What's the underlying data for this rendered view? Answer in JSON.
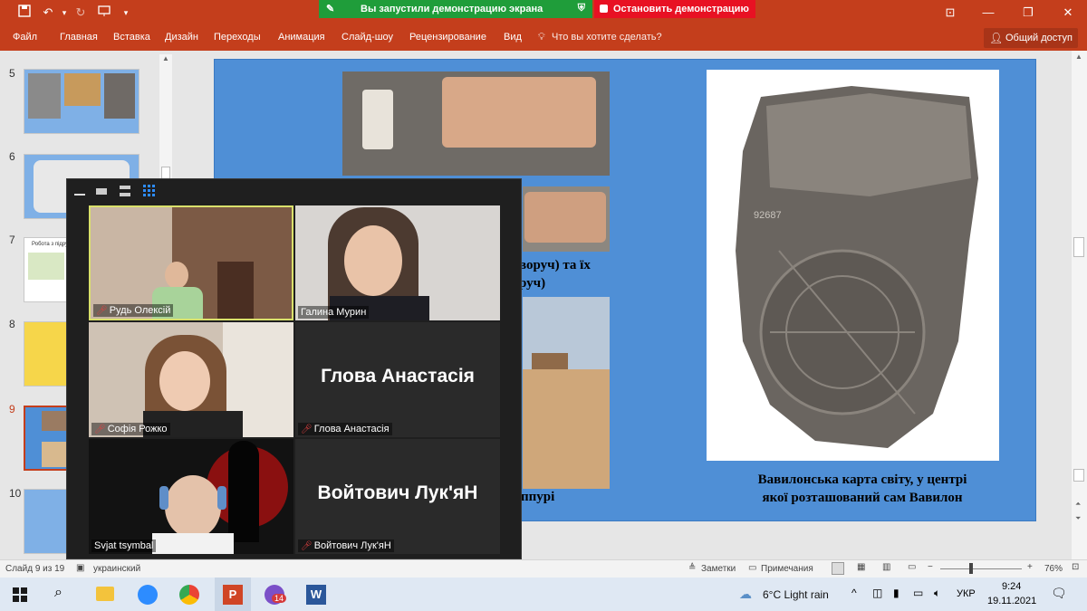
{
  "quick_access": {
    "save_icon": "save-icon",
    "undo_icon": "undo-icon",
    "redo_icon": "redo-icon",
    "present_icon": "present-icon"
  },
  "screen_share": {
    "message": "Вы запустили демонстрацию экрана",
    "stop_label": "Остановить демонстрацию"
  },
  "ribbon": {
    "tabs": [
      "Файл",
      "Главная",
      "Вставка",
      "Дизайн",
      "Переходы",
      "Анимация",
      "Слайд-шоу",
      "Рецензирование",
      "Вид"
    ],
    "tell_me": "Что вы хотите сделать?",
    "share_label": "Общий доступ"
  },
  "thumbnails": [
    {
      "num": "5"
    },
    {
      "num": "6"
    },
    {
      "num": "7",
      "text": "Робота з підру"
    },
    {
      "num": "8"
    },
    {
      "num": "9"
    },
    {
      "num": "10"
    }
  ],
  "slide": {
    "caption_left_1": "воруч) та їх",
    "caption_left_2": "руч)",
    "caption_bottom_left": "ппурі",
    "map_number": "92687",
    "caption_right_1": "Вавилонська карта світу,  у центрі",
    "caption_right_2": "якої розташований сам Вавилон"
  },
  "zoom": {
    "participants": [
      {
        "label": "Рудь Олексій",
        "video": true
      },
      {
        "label": "Галина Мурин",
        "video": true
      },
      {
        "label": "Софія Рожко",
        "video": true
      },
      {
        "label": "Глова Анастасія",
        "big": "Глова Анастасія",
        "video": false
      },
      {
        "label": "Svjat tsymbal",
        "video": true
      },
      {
        "label": "Войтович Лук'яН",
        "big": "Войтович Лук'яН",
        "video": false
      }
    ]
  },
  "status": {
    "slide_info": "Слайд 9 из 19",
    "language": "украинский",
    "notes": "Заметки",
    "comments": "Примечания",
    "zoom": "76%"
  },
  "taskbar": {
    "weather": "6°C  Light rain",
    "lang": "УКР",
    "time": "9:24",
    "date": "19.11.2021",
    "viber_badge": "14"
  },
  "colors": {
    "ppt_accent": "#c43e1c",
    "share_green": "#1f9d3a",
    "stop_red": "#e81123",
    "slide_bg": "#4f8fd6"
  }
}
